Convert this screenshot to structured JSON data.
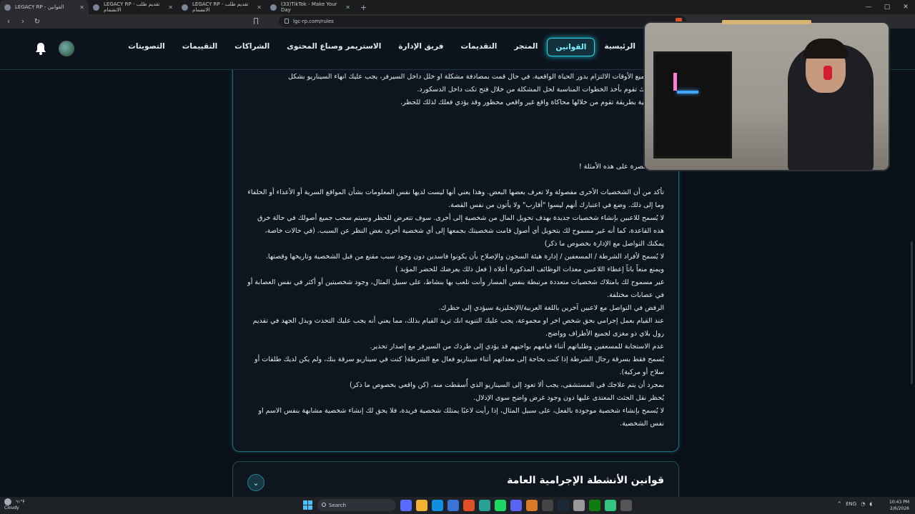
{
  "browser": {
    "tabs": [
      {
        "title": "LEGACY RP - القوانين",
        "active": true
      },
      {
        "title": "LEGACY RP - تقديم طلب الانضمام",
        "active": false
      },
      {
        "title": "LEGACY RP - تقديم طلب الانضمام",
        "active": false
      },
      {
        "title": "(33)TikTok - Make Your Day",
        "active": false
      }
    ],
    "new_tab": "+",
    "url": "lgc-rp.com/rules"
  },
  "header": {
    "nav": [
      {
        "label": "الرئيسية",
        "active": false
      },
      {
        "label": "القوانين",
        "active": true
      },
      {
        "label": "المتجر",
        "active": false
      },
      {
        "label": "التقديمات",
        "active": false
      },
      {
        "label": "فريق الإدارة",
        "active": false
      },
      {
        "label": "الاستريمر وصناع المحتوى",
        "active": false
      },
      {
        "label": "الشراكات",
        "active": false
      },
      {
        "label": "التقييمات",
        "active": false
      },
      {
        "label": "التصويتات",
        "active": false
      }
    ]
  },
  "rules": {
    "lines": [
      "يك ويجميع الأوقات الالتزام بدور الحياة الواقعية. في حال قمت بمصادفة مشكلة او خلل داخل السيرفر، يجب عليك انهاء السيناريو بشكل",
      "وبعد ذلك تقوم بأخذ الخطوات المناسبة لحل المشكلة من خلال فتح تكت داخل الدسكورد.",
      "الشخصية بطريقة تقوم من خلالها محاكاة واقع غير واقعي محظور وقد يؤدي فعلك لذلك للحظر.",
      "",
      "ن.",
      "مان.",
      "",
      "غير مقتصرة على هذه الأمثلة !",
      "",
      "تأكد من أن الشخصيات الأخرى مفصولة ولا تعرف بعضها البعض. وهذا يعني أنها ليست لديها نفس المعلومات بشأن المواقع السرية أو الأعداء أو الحلفاء وما إلى ذلك. وضع في اعتبارك أنهم ليسوا \"أقارب\" ولا يأتون من نفس القصة.",
      "لا يُسمح للاعبين بإنشاء شخصيات جديدة بهدف تحويل المال من شخصية إلى أخرى. سوف تتعرض للحظر وسيتم سحب جميع أصولك في حالة خرق هذه القاعدة، كما أنه غير مسموح لك بتحويل أي أصول قامت شخصيتك بجمعها إلى أي شخصية أخرى بغض النظر عن السبب. (في حالات خاصة، يمكنك التواصل مع الإدارة بخصوص ما ذكر)",
      "لا يُسمح لأفراد الشرطة / المسعفين / إدارة هيئة السجون والإصلاح بأن يكونوا فاسدين دون وجود سبب مقنع من قبل الشخصية وتاريخها وقصتها.",
      "ويمنع منعاً باتاً إعطاء اللاعبين معدات الوظائف المذكورة أعلاه ( فعل ذلك يعرضك للحضر المؤبد )",
      "غير مسموح لك بامتلاك شخصيات متعددة مرتبطة بنفس المسار وأنت تلعب بها بنشاط، على سبيل المثال، وجود شخصيتين أو أكثر في نفس العصابة أو في عصابات مختلفة.",
      "الرفض في التواصل مع لاعبين آخرين باللغة العربية/الإنجليزية سيؤدي إلى حظرك.",
      "عند القيام بعمل إجرامي بحق شخص اخر او مجموعة، يجب عليك التنويه انك تريد القيام بذلك، مما يعني أنه يجب عليك التحدث وبذل الجهد في تقديم رول بلاي ذو مغزى لجميع الأطراف وواضح.",
      "عدم الاستجابة للمسعفين وطلباتهم أثناء قيامهم بواجبهم قد يؤدي إلى طردك من السيرفر مع إصدار تحذير.",
      "يُسمح فقط بسرقة رجال الشرطة إذا كنت بحاجة إلى معداتهم أثناء سيناريو فعال مع الشرطة( كنت في سيناريو سرقة بنك، ولم يكن لديك طلقات أو سلاح أو مركبة).",
      "بمجرد أن يتم علاجك في المستشفى، يجب ألا تعود إلى السيناريو الذي أُسقطت منه. (كن واقعي بخصوص ما ذكر)",
      "يُحظر نقل الجثث المعتدى عليها دون وجود غرض واضح سوى الإذلال.",
      "لا يُسمح بإنشاء شخصية موجودة بالفعل، على سبيل المثال، إذا رأيت لاعبًا يمتلك شخصية فريدة، فلا يحق لك إنشاء شخصية مشابهة بنفس الاسم او نفس الشخصية."
    ]
  },
  "section2": {
    "title": "قوانين الأنشطة الإجرامية العامة",
    "toggle_icon": "chevron-down-icon"
  },
  "taskbar": {
    "temp": "٦١°F",
    "weather": "Cloudy",
    "search_placeholder": "Search",
    "lang": "ENG",
    "time": "10:43 PM",
    "date": "2/6/2026"
  }
}
